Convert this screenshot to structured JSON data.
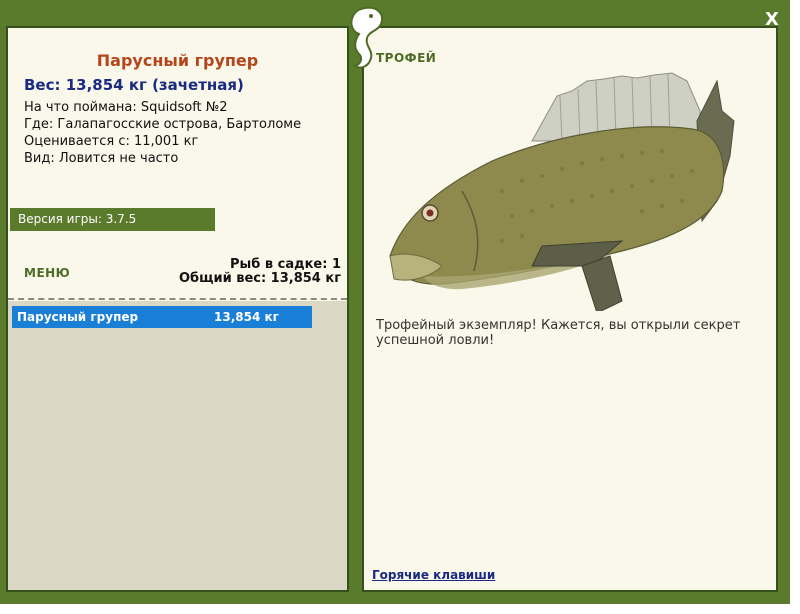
{
  "fish": {
    "name": "Парусный групер",
    "weight": "Вес: 13,854 кг (зачетная)",
    "caught_with": "На что поймана: Squidsoft №2",
    "location": "Где: Галапагосские острова, Бартоломе",
    "rated_from": "Оценивается с: 11,001 кг",
    "rarity": "Вид: Ловится не часто"
  },
  "version": "Версия игры: 3.7.5",
  "menu_label": "МЕНЮ",
  "stats": {
    "fish_count": "Рыб в садке: 1",
    "total_weight": "Общий вес: 13,854 кг"
  },
  "catch_list": [
    {
      "name": "Парусный групер",
      "weight": "13,854 кг"
    }
  ],
  "trophy": {
    "heading": "ТРОФЕЙ",
    "text": "Трофейный экземпляр! Кажется, вы открыли секрет успешной ловли!",
    "hotkeys": "Горячие клавиши"
  },
  "close_label": "X",
  "colors": {
    "frame": "#5b7b2c",
    "panel": "#f9f8ea",
    "title": "#b5451b",
    "weight": "#1a2a82",
    "selection": "#1a7fd6"
  },
  "icons": {
    "logo": "seahorse-logo-icon",
    "close": "close-icon"
  }
}
